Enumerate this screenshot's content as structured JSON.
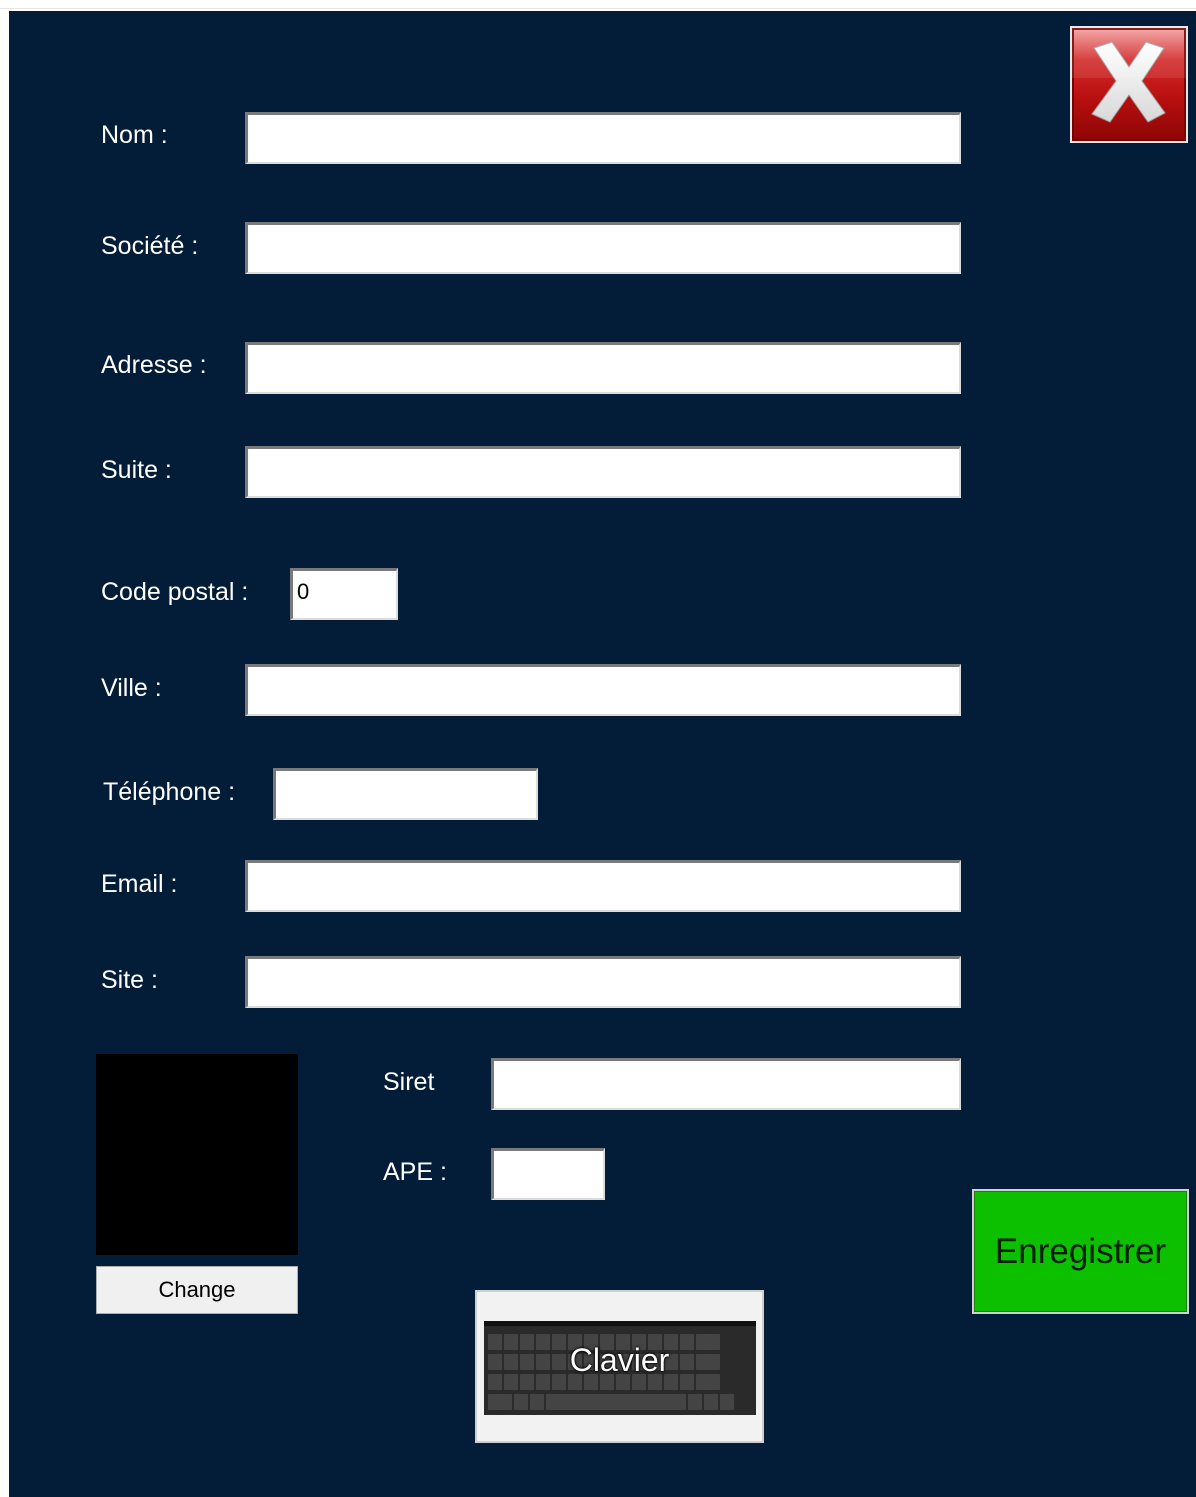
{
  "window": {
    "close_icon": "close-x-icon"
  },
  "form": {
    "nom": {
      "label": "Nom :",
      "value": ""
    },
    "societe": {
      "label": "Société :",
      "value": ""
    },
    "adresse": {
      "label": "Adresse :",
      "value": ""
    },
    "suite": {
      "label": "Suite :",
      "value": ""
    },
    "code_postal": {
      "label": "Code postal :",
      "value": "0"
    },
    "ville": {
      "label": "Ville :",
      "value": ""
    },
    "telephone": {
      "label": "Téléphone :",
      "value": ""
    },
    "email": {
      "label": "Email :",
      "value": ""
    },
    "site": {
      "label": "Site :",
      "value": ""
    },
    "siret": {
      "label": "Siret",
      "value": ""
    },
    "ape": {
      "label": "APE :",
      "value": ""
    }
  },
  "logo": {
    "change_label": "Change"
  },
  "actions": {
    "save_label": "Enregistrer",
    "keyboard_label": "Clavier",
    "keyboard_icon": "on-screen-keyboard-icon"
  },
  "colors": {
    "background": "#031d38",
    "save_button": "#0cc000",
    "close_button": "#c41a1a"
  }
}
